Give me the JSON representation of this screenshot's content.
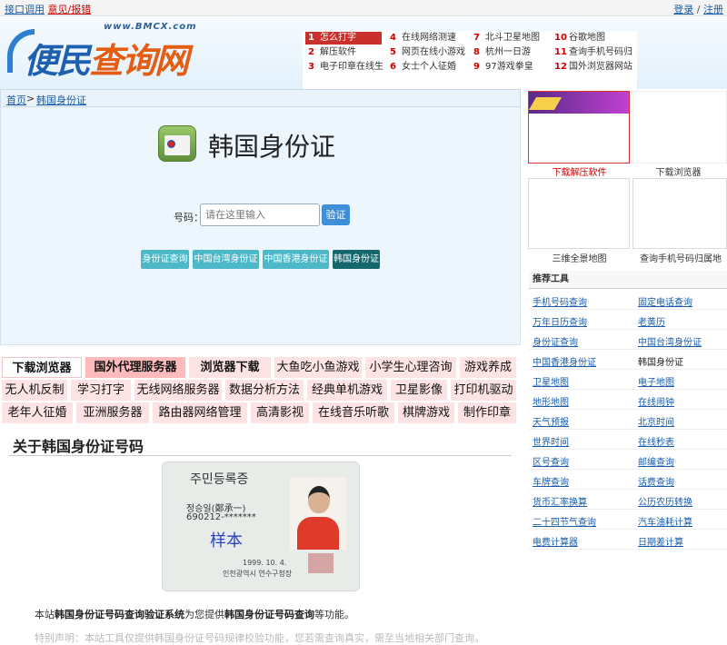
{
  "topbar": {
    "api": "接口调用",
    "feedback": "意见/报错",
    "login": "登录",
    "sep": " / ",
    "register": "注册"
  },
  "header": {
    "site_url": "www.BMCX.com",
    "logo_text_1": "便民",
    "logo_text_2": "查询网",
    "hot": [
      {
        "n": "1",
        "label": "怎么打字"
      },
      {
        "n": "4",
        "label": "在线网络测速"
      },
      {
        "n": "7",
        "label": "北斗卫星地图"
      },
      {
        "n": "10",
        "label": "谷歌地图"
      },
      {
        "n": "2",
        "label": "解压软件"
      },
      {
        "n": "5",
        "label": "网页在线小游戏"
      },
      {
        "n": "8",
        "label": "杭州一日游"
      },
      {
        "n": "11",
        "label": "查询手机号码归"
      },
      {
        "n": "3",
        "label": "电子印章在线生"
      },
      {
        "n": "6",
        "label": "女士个人征婚"
      },
      {
        "n": "9",
        "label": "97游戏拳皇"
      },
      {
        "n": "12",
        "label": "国外浏览器网站"
      }
    ]
  },
  "breadcrumb": {
    "home": "首页",
    "sep": " > ",
    "current": "韩国身份证"
  },
  "tool": {
    "title": "韩国身份证",
    "label": "号码：",
    "placeholder": "请在这里输入",
    "button": "验证",
    "tabs": [
      "身份证查询",
      "中国台湾身份证",
      "中国香港身份证",
      "韩国身份证"
    ]
  },
  "links": [
    [
      "下载浏览器",
      "国外代理服务器",
      "浏览器下载",
      "大鱼吃小鱼游戏",
      "小学生心理咨询",
      "游戏养成"
    ],
    [
      "无人机反制",
      "学习打字",
      "无线网络服务器",
      "数据分析方法",
      "经典单机游戏",
      "卫星影像",
      "打印机驱动"
    ],
    [
      "老年人征婚",
      "亚洲服务器",
      "路由器网络管理",
      "高清影视",
      "在线音乐听歌",
      "棋牌游戏",
      "制作印章"
    ]
  ],
  "about": {
    "heading": "关于韩国身份证号码",
    "card": {
      "title": "주민등록증",
      "name": "정승일(鄭承一)",
      "number": "690212-*******",
      "mark": "样本",
      "date": "1999. 10. 4.",
      "issuer": "인천광역시 연수구청장"
    },
    "p1": {
      "pre": "本站",
      "b1": "韩国身份证号码查询验证系统",
      "mid": "为您提供",
      "b2": "韩国身份证号码查询",
      "post": "等功能。"
    },
    "p2": "特别声明：本站工具仅提供韩国身份证号码规律校验功能，您若需查询真实，需至当地相关部门查询。"
  },
  "side": {
    "thumbs": [
      {
        "caption": "下载解压软件"
      },
      {
        "caption": "下载浏览器"
      },
      {
        "caption": "三维全景地图"
      },
      {
        "caption": "查询手机号码归属地"
      }
    ],
    "tools_head": "推荐工具",
    "tools": [
      [
        "手机号码查询",
        "固定电话查询"
      ],
      [
        "万年日历查询",
        "老黄历"
      ],
      [
        "身份证查询",
        "中国台湾身份证"
      ],
      [
        "中国香港身份证",
        "韩国身份证"
      ],
      [
        "卫星地图",
        "电子地图"
      ],
      [
        "地形地图",
        "在线闹钟"
      ],
      [
        "天气预报",
        "北京时间"
      ],
      [
        "世界时间",
        "在线秒表"
      ],
      [
        "区号查询",
        "邮编查询"
      ],
      [
        "车牌查询",
        "话费查询"
      ],
      [
        "货币汇率换算",
        "公历农历转换"
      ],
      [
        "二十四节气查询",
        "汽车油耗计算"
      ],
      [
        "电费计算器",
        "日期差计算"
      ]
    ]
  }
}
